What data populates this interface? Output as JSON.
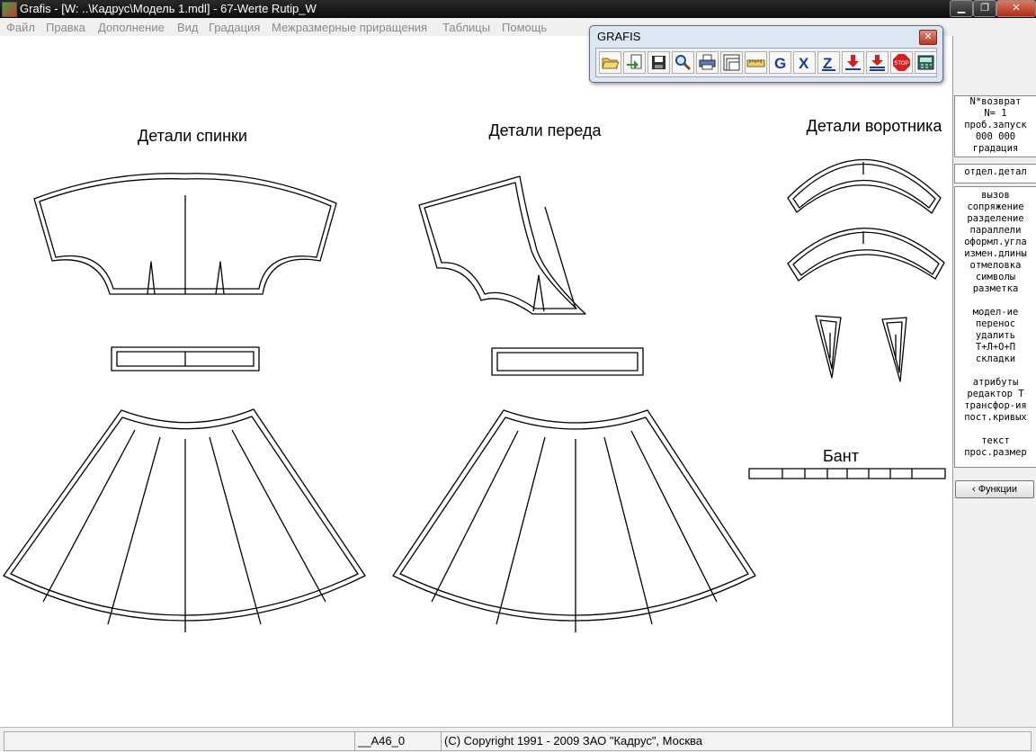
{
  "window": {
    "title": "Grafis - [W: ..\\Кадрус\\Модель 1.mdl] - 67-Werte Rutip_W",
    "controls": {
      "minimize": "▁",
      "restore": "❐",
      "close": "✕"
    }
  },
  "menu": [
    "Файл",
    "Правка",
    "Дополнение",
    "Вид",
    "Градация",
    "Межразмерные приращения",
    "Таблицы",
    "Помощь"
  ],
  "toolbar_window": {
    "title": "GRAFIS",
    "close": "✕",
    "tools": [
      "open-folder-icon",
      "import-icon",
      "save-icon",
      "zoom-icon",
      "print-icon",
      "layers-icon",
      "ruler-icon",
      "g-icon",
      "x-icon",
      "z-icon",
      "download-icon",
      "download-all-icon",
      "stop-icon",
      "calculator-icon"
    ],
    "stop_label": "STOP"
  },
  "drawing": {
    "labels": {
      "back": "Детали спинки",
      "front": "Детали переда",
      "collar": "Детали воротника",
      "bow": "Бант"
    }
  },
  "side_panel": {
    "info": [
      "N*возврат",
      "N=  1",
      "проб.запуск",
      "000 000",
      "градация"
    ],
    "single": [
      "отдел.детал"
    ],
    "functions": [
      "вызов",
      "сопряжение",
      "разделение",
      "параллели",
      "оформл.угла",
      "измен.длины",
      "отмеловка",
      "символы",
      "разметка",
      "",
      "модел-ие",
      "перенос",
      "удалить",
      "Т+Л+О+П",
      "складки",
      "",
      "атрибуты",
      "редактор Т",
      "трансфор-ия",
      "пост.кривых",
      "",
      "текст",
      "прос.размер"
    ],
    "button": "‹ Функции"
  },
  "status": {
    "cell1": "",
    "cell2": "__A46_0",
    "copyright": "(C) Copyright 1991 - 2009 ЗАО \"Кадрус\", Москва"
  }
}
